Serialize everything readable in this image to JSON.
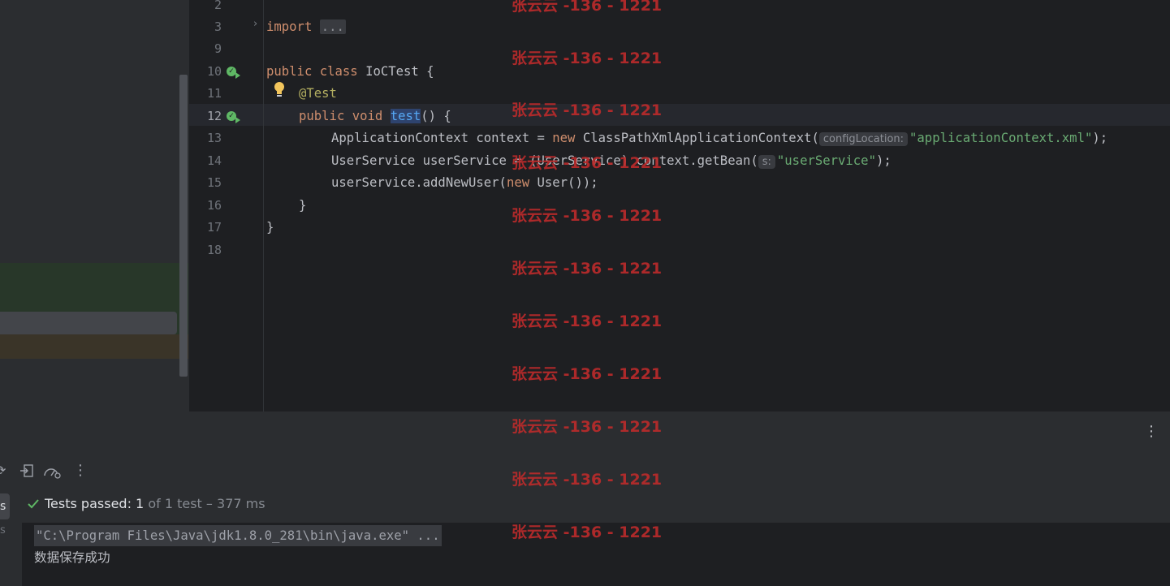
{
  "editor": {
    "line_numbers": [
      "2",
      "3",
      "9",
      "10",
      "11",
      "12",
      "13",
      "14",
      "15",
      "16",
      "17",
      "18"
    ],
    "current_line": "12",
    "code": {
      "l3_import": "import",
      "l3_fold": "...",
      "l10_public": "public",
      "l10_class": "class",
      "l10_rest": "IoCTest {",
      "l11_annotation": "@Test",
      "l12_public": "public",
      "l12_void": "void",
      "l12_method": "test",
      "l12_rest": "() {",
      "l13_a": "ApplicationContext context = ",
      "l13_new": "new",
      "l13_b": " ClassPathXmlApplicationContext(",
      "l13_hint": "configLocation:",
      "l13_str": "\"applicationContext.xml\"",
      "l13_end": ");",
      "l14_a": "UserService userService = (UserService) context.getBean(",
      "l14_hint": "s:",
      "l14_str": "\"userService\"",
      "l14_end": ");",
      "l15_a": "userService.addNewUser(",
      "l15_new": "new",
      "l15_b": " User());",
      "l16": "}",
      "l17": "}"
    }
  },
  "run_panel": {
    "header_more": "⋮",
    "toolbar_more": "⋮",
    "left_tab_selected": "s",
    "left_tab_second": "s",
    "status": {
      "label": "Tests passed:",
      "passed": "1",
      "of_total": "of 1 test",
      "separator": "–",
      "duration": "377 ms"
    },
    "console": {
      "command": "\"C:\\Program Files\\Java\\jdk1.8.0_281\\bin\\java.exe\" ...",
      "output": "数据保存成功"
    }
  },
  "watermark": {
    "text": "张云云 -136 - 1221"
  },
  "colors": {
    "background": "#1e1f22",
    "panel": "#2b2d30",
    "keyword": "#cf8e6d",
    "string": "#6aab73",
    "annotation": "#b3ae60",
    "success": "#5fb865",
    "watermark": "#bd2b2b"
  },
  "icons": [
    "run-test-icon",
    "intention-bulb-icon",
    "fold-arrow-icon",
    "check-icon",
    "more-icon",
    "rerun-icon",
    "export-icon",
    "coverage-icon"
  ]
}
